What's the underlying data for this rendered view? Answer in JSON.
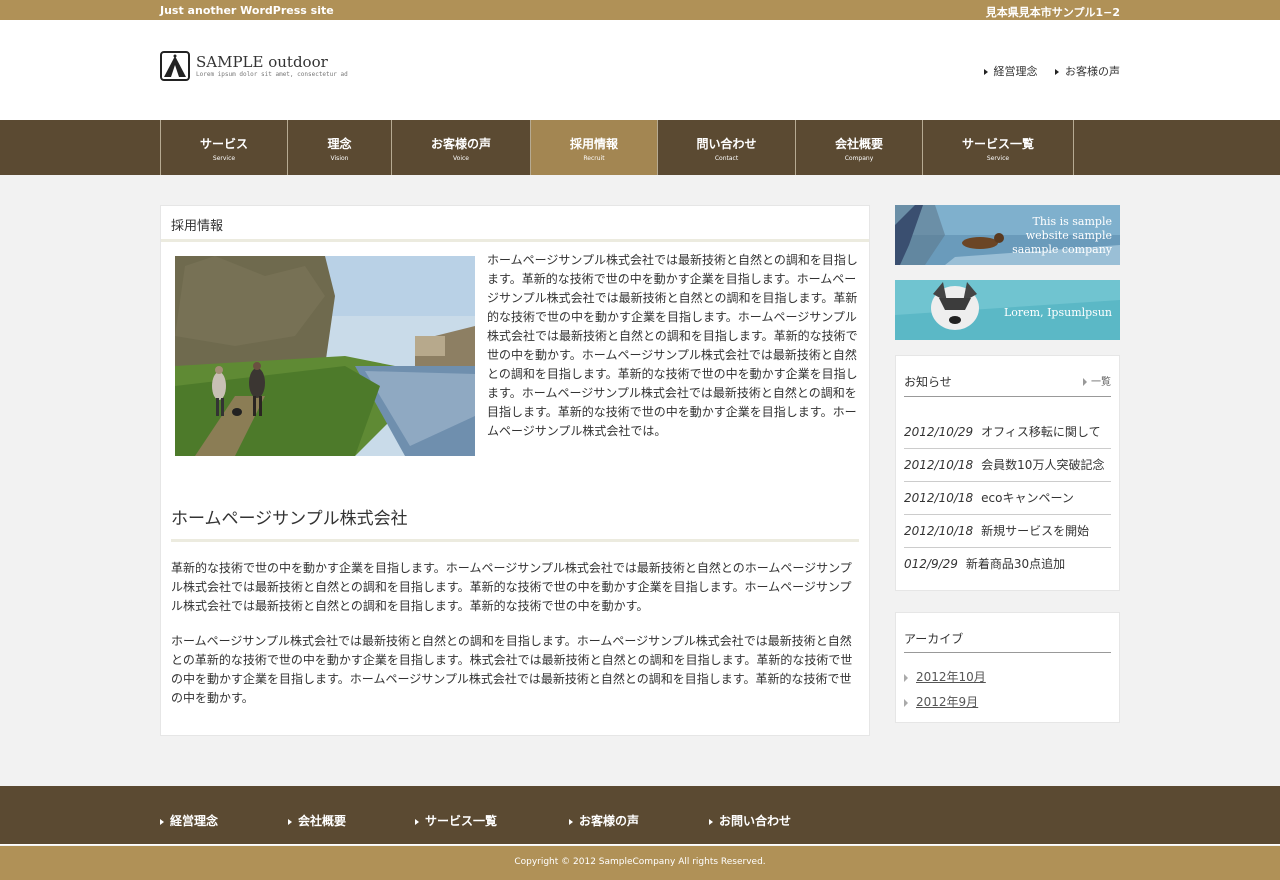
{
  "topbar": {
    "tagline": "Just another WordPress site",
    "address": "見本県見本市サンプル1−2"
  },
  "header": {
    "logo_text": "SAMPLE outdoor",
    "logo_sub": "Lorem ipsum dolor sit amet, consectetur ad",
    "links": [
      "経営理念",
      "お客様の声"
    ]
  },
  "nav": {
    "items": [
      {
        "label": "サービス",
        "sub": "Service"
      },
      {
        "label": "理念",
        "sub": "Vision"
      },
      {
        "label": "お客様の声",
        "sub": "Voice"
      },
      {
        "label": "採用情報",
        "sub": "Recruit"
      },
      {
        "label": "問い合わせ",
        "sub": "Contact"
      },
      {
        "label": "会社概要",
        "sub": "Company"
      },
      {
        "label": "サービス一覧",
        "sub": "Service"
      }
    ]
  },
  "main": {
    "page_title": "採用情報",
    "intro": "ホームページサンプル株式会社では最新技術と自然との調和を目指します。革新的な技術で世の中を動かす企業を目指します。ホームページサンプル株式会社では最新技術と自然との調和を目指します。革新的な技術で世の中を動かす企業を目指します。ホームページサンプル株式会社では最新技術と自然との調和を目指します。革新的な技術で世の中を動かす。ホームページサンプル株式会社では最新技術と自然との調和を目指します。革新的な技術で世の中を動かす企業を目指します。ホームページサンプル株式会社では最新技術と自然との調和を目指します。革新的な技術で世の中を動かす企業を目指します。ホームページサンプル株式会社では。",
    "heading": "ホームページサンプル株式会社",
    "para1": "革新的な技術で世の中を動かす企業を目指します。ホームページサンプル株式会社では最新技術と自然とのホームページサンプル株式会社では最新技術と自然との調和を目指します。革新的な技術で世の中を動かす企業を目指します。ホームページサンプル株式会社では最新技術と自然との調和を目指します。革新的な技術で世の中を動かす。",
    "para2": "ホームページサンプル株式会社では最新技術と自然との調和を目指します。ホームページサンプル株式会社では最新技術と自然との革新的な技術で世の中を動かす企業を目指します。株式会社では最新技術と自然との調和を目指します。革新的な技術で世の中を動かす企業を目指します。ホームページサンプル株式会社では最新技術と自然との調和を目指します。革新的な技術で世の中を動かす。"
  },
  "sidebar": {
    "banner1": [
      "This is sample",
      "website sample",
      "saample company"
    ],
    "banner2": "Lorem, Ipsumlpsun",
    "news": {
      "title": "お知らせ",
      "more": "一覧",
      "items": [
        {
          "date": "2012/10/29",
          "text": "オフィス移転に関して"
        },
        {
          "date": "2012/10/18",
          "text": "会員数10万人突破記念"
        },
        {
          "date": "2012/10/18",
          "text": "ecoキャンペーン"
        },
        {
          "date": "2012/10/18",
          "text": "新規サービスを開始"
        },
        {
          "date": "012/9/29",
          "text": "新着商品30点追加"
        }
      ]
    },
    "archive": {
      "title": "アーカイブ",
      "items": [
        "2012年10月",
        "2012年9月"
      ]
    }
  },
  "footer": {
    "links": [
      "経営理念",
      "会社概要",
      "サービス一覧",
      "お客様の声",
      "お問い合わせ"
    ],
    "copyright": "Copyright © 2012 SampleCompany All rights Reserved."
  }
}
